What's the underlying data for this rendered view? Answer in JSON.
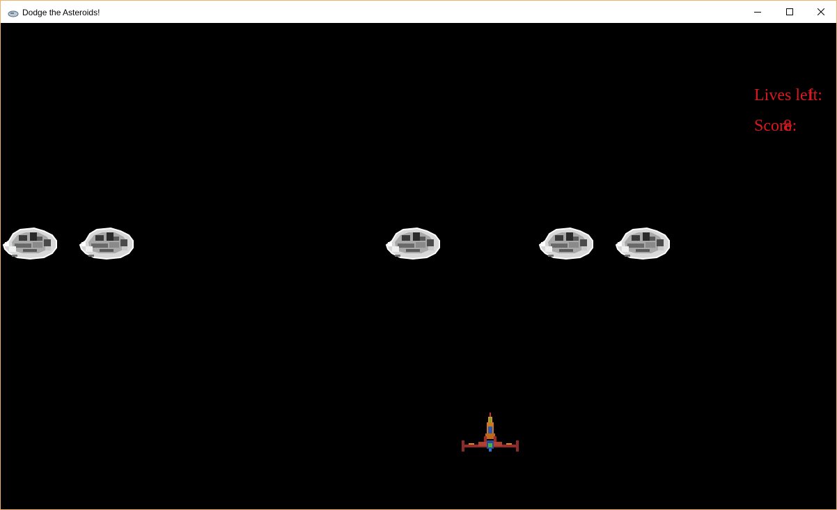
{
  "window": {
    "title": "Dodge the Asteroids!",
    "icon": "asteroid-app-icon",
    "controls": [
      "minimize-icon",
      "maximize-icon",
      "close-icon"
    ]
  },
  "hud": {
    "lives_label": "Lives left:",
    "lives_value": "1",
    "score_label": "Score:",
    "score_value": "8",
    "color": "#d81820"
  },
  "game": {
    "background": "#000000",
    "asteroid_count": 5,
    "player": "spaceship"
  }
}
